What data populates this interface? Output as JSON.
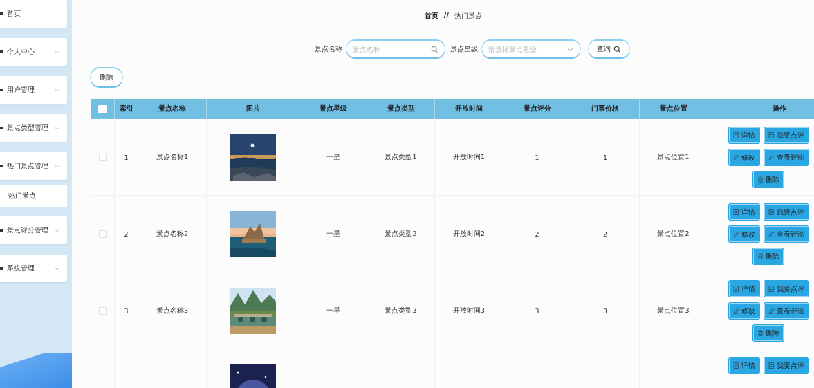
{
  "sidebar": {
    "items": [
      {
        "label": "首页",
        "kind": "link",
        "selected": false
      },
      {
        "label": "个人中心",
        "kind": "menu",
        "selected": false
      },
      {
        "label": "用户管理",
        "kind": "menu",
        "selected": false
      },
      {
        "label": "景点类型管理",
        "kind": "menu",
        "selected": false
      },
      {
        "label": "热门景点管理",
        "kind": "menu",
        "selected": false,
        "children": [
          {
            "label": "热门景点",
            "selected": true
          }
        ]
      },
      {
        "label": "景点评分管理",
        "kind": "menu",
        "selected": false
      },
      {
        "label": "系统管理",
        "kind": "menu",
        "selected": false
      }
    ]
  },
  "breadcrumb": [
    "首页",
    "//",
    "热门景点"
  ],
  "search": {
    "fields": [
      {
        "label": "景点名称",
        "kind": "text",
        "placeholder": "景点名称"
      },
      {
        "label": "景点星级",
        "kind": "select",
        "placeholder": "请选择景点星级"
      }
    ],
    "button": "查询"
  },
  "toolbar": {
    "delete_button": "删除"
  },
  "table": {
    "select_all": {
      "checked": false
    },
    "columns": [
      "索引",
      "景点名称",
      "图片",
      "景点星级",
      "景点类型",
      "开放时间",
      "景点评分",
      "门票价格",
      "景点位置",
      "操作"
    ],
    "rows": [
      {
        "checked": false,
        "cells": [
          "1",
          "景点名称1",
          {
            "kind": "picture"
          },
          "一星",
          "景点类型1",
          "开放时间1",
          "1",
          "1",
          "景点位置1"
        ],
        "actions": [
          {
            "label": "详情",
            "kind": "doc"
          },
          {
            "label": "我要点评",
            "kind": "doc"
          },
          {
            "label": "修改",
            "kind": "pen"
          },
          {
            "label": "查看评论",
            "kind": "pen"
          },
          {
            "label": "删除",
            "kind": "trash"
          }
        ]
      },
      {
        "checked": false,
        "cells": [
          "2",
          "景点名称2",
          {
            "kind": "picture"
          },
          "一星",
          "景点类型2",
          "开放时间2",
          "2",
          "2",
          "景点位置2"
        ],
        "actions": [
          {
            "label": "详情",
            "kind": "doc"
          },
          {
            "label": "我要点评",
            "kind": "doc"
          },
          {
            "label": "修改",
            "kind": "pen"
          },
          {
            "label": "查看评论",
            "kind": "pen"
          },
          {
            "label": "删除",
            "kind": "trash"
          }
        ]
      },
      {
        "checked": false,
        "cells": [
          "3",
          "景点名称3",
          {
            "kind": "picture"
          },
          "一星",
          "景点类型3",
          "开放时间3",
          "3",
          "3",
          "景点位置3"
        ],
        "actions": [
          {
            "label": "详情",
            "kind": "doc"
          },
          {
            "label": "我要点评",
            "kind": "doc"
          },
          {
            "label": "修改",
            "kind": "pen"
          },
          {
            "label": "查看评论",
            "kind": "pen"
          },
          {
            "label": "删除",
            "kind": "trash"
          }
        ]
      },
      {
        "cells": [
          null,
          null,
          {
            "kind": "picture"
          }
        ],
        "actions": [
          {
            "label": "详情",
            "kind": "doc"
          },
          {
            "label": "我要点评",
            "kind": "doc"
          }
        ]
      }
    ]
  }
}
